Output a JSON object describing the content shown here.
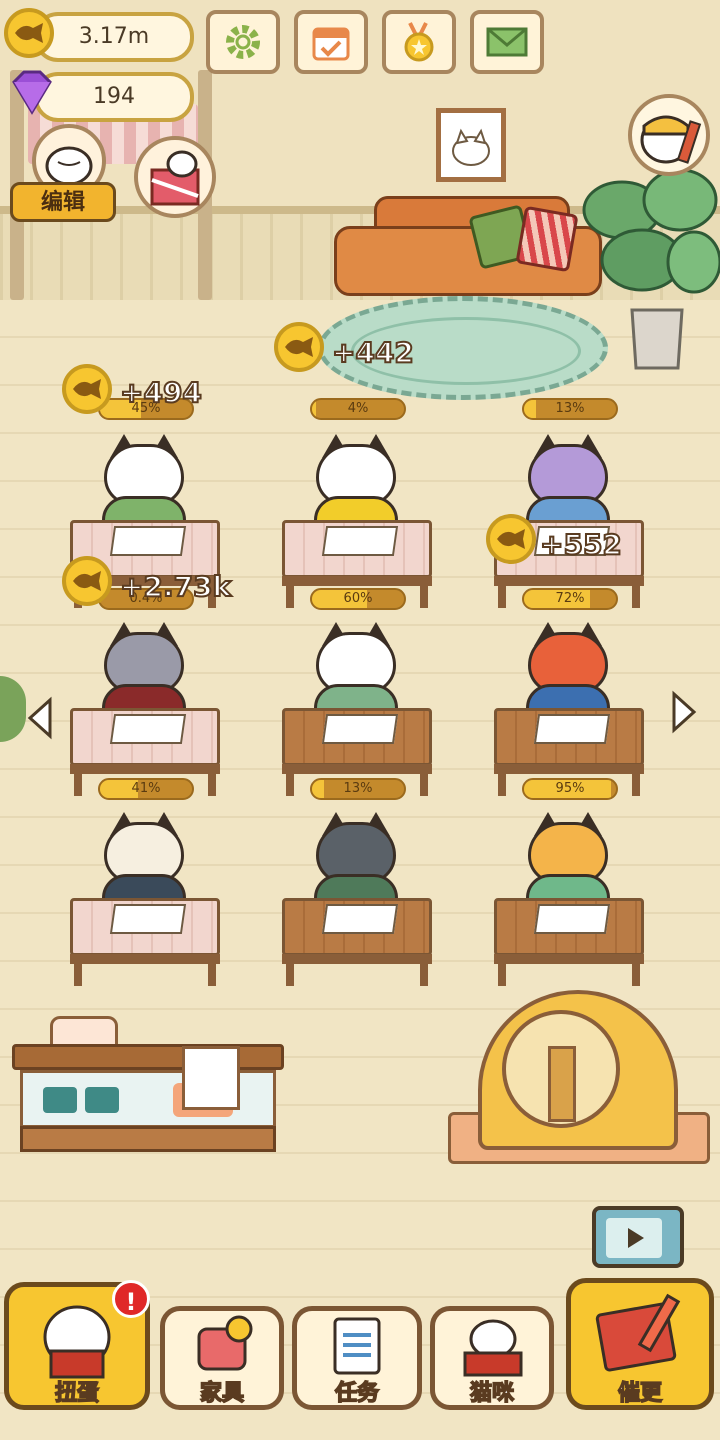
{
  "hud": {
    "fish_amount": "3.17m",
    "gem_amount": "194",
    "buttons": [
      {
        "name": "settings",
        "icon": "gear-icon"
      },
      {
        "name": "calendar",
        "icon": "calendar-check-icon"
      },
      {
        "name": "achievements",
        "icon": "medal-icon"
      },
      {
        "name": "mail",
        "icon": "envelope-icon"
      }
    ]
  },
  "edit_label": "编辑",
  "floating_rewards": [
    "+494",
    "+442",
    "+552",
    "+2.73k"
  ],
  "desks": [
    {
      "cat": "white-tabby",
      "progress_text": "45%",
      "progress": 0.45,
      "desk": "pink"
    },
    {
      "cat": "calico",
      "progress_text": "4%",
      "progress": 0.04,
      "desk": "pink"
    },
    {
      "cat": "purple",
      "progress_text": "13%",
      "progress": 0.13,
      "desk": "pink"
    },
    {
      "cat": "eyepatch-grey",
      "progress_text": "0.4%",
      "progress": 0.004,
      "desk": "pink"
    },
    {
      "cat": "white-suspenders",
      "progress_text": "60%",
      "progress": 0.6,
      "desk": "wood"
    },
    {
      "cat": "orange-spotted",
      "progress_text": "72%",
      "progress": 0.72,
      "desk": "wood"
    },
    {
      "cat": "tophat-cream",
      "progress_text": "41%",
      "progress": 0.41,
      "desk": "pink"
    },
    {
      "cat": "grey-tuxedo",
      "progress_text": "13%",
      "progress": 0.13,
      "desk": "wood"
    },
    {
      "cat": "orange-scarf-glasses",
      "progress_text": "95%",
      "progress": 0.95,
      "desk": "wood"
    }
  ],
  "nav": {
    "gacha": "扭蛋",
    "furniture": "家具",
    "tasks": "任务",
    "cats": "猫咪",
    "catch": "催更"
  },
  "colors": {
    "gold": "#f7c630",
    "wood": "#b97b45",
    "gem": "#9b4fd6",
    "alert": "#e02828"
  }
}
